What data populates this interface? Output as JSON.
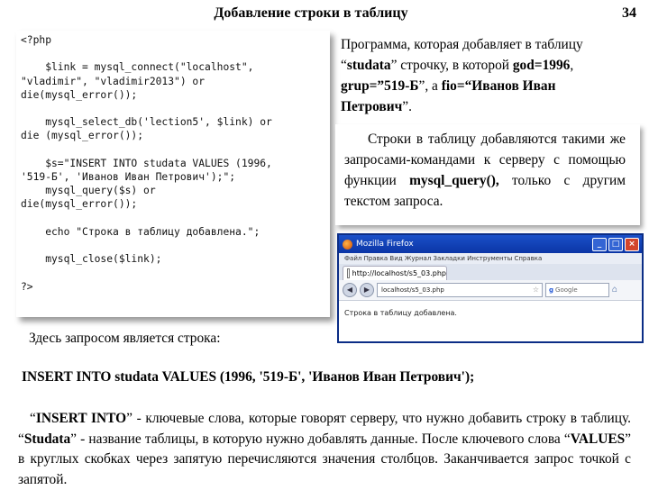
{
  "header": {
    "title": "Добавление строки в таблицу",
    "page_number": "34"
  },
  "code": {
    "lines": [
      "<?php",
      "",
      "    $link = mysql_connect(\"localhost\",",
      "\"vladimir\", \"vladimir2013\") or",
      "die(mysql_error());",
      "",
      "    mysql_select_db('lection5', $link) or",
      "die (mysql_error());",
      "",
      "    $s=\"INSERT INTO studata VALUES (1996,",
      "'519-Б', 'Иванов Иван Петрович');\";",
      "    mysql_query($s) or",
      "die(mysql_error());",
      "",
      "    echo \"Строка в таблицу добавлена.\";",
      "",
      "    mysql_close($link);",
      "",
      "?>"
    ]
  },
  "description": {
    "p1": "Программа, которая добавляет в таблицу “",
    "p2": "studata",
    "p3": "” строчку, в которой ",
    "p4": "god=1996",
    "p5": ", ",
    "p6": "grup=”519-Б",
    "p7": "”, а ",
    "p8": "fio=“Иванов Иван Петрович",
    "p9": "”."
  },
  "note": {
    "p1": "Строки в таблицу добавляются такими же запросами-командами к серверу с помощью функции ",
    "p2": "mysql_query(),",
    "p3": " только с другим текстом запроса."
  },
  "browser": {
    "window_title": "Mozilla Firefox",
    "menu": "Файл  Правка  Вид  Журнал  Закладки  Инструменты  Справка",
    "tab_label": "http://localhost/s5_03.php",
    "url": "localhost/s5_03.php",
    "search_placeholder": "Google",
    "content_text": "Строка в таблицу добавлена."
  },
  "body_text": {
    "here_label": "Здесь запросом является строка:",
    "query": "INSERT INTO studata VALUES (1996, '519-Б', 'Иванов Иван Петрович');",
    "explain_1": "“",
    "explain_2": "INSERT INTO",
    "explain_3": "” - ключевые слова, которые говорят серверу, что нужно добавить строку в таблицу. “",
    "explain_4": "Studata",
    "explain_5": "” - название таблицы, в которую нужно добавлять данные. После ключевого слова “",
    "explain_6": "VALUES",
    "explain_7": "” в круглых скобках через запятую перечисляются значения столбцов. Заканчивается запрос точкой с запятой."
  }
}
